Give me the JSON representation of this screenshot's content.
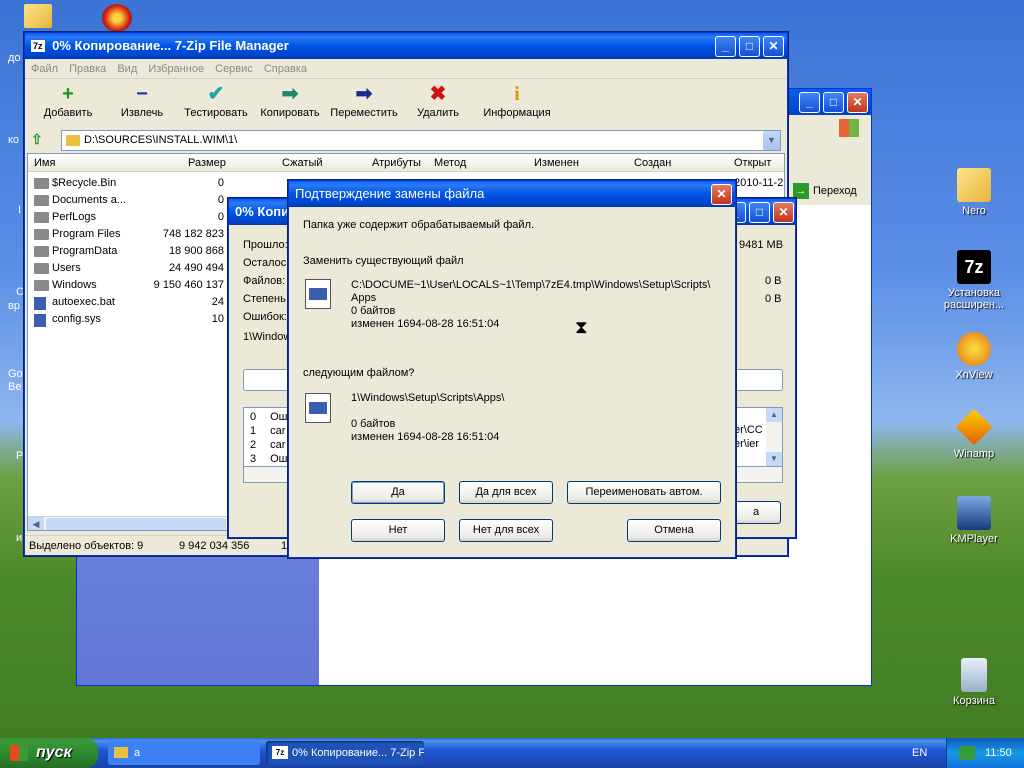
{
  "desktop_icons": [
    {
      "id": "nero",
      "label": "Nero"
    },
    {
      "id": "7zip",
      "label": "Установка расширен..."
    },
    {
      "id": "xnview",
      "label": "XnView"
    },
    {
      "id": "winamp",
      "label": "Winamp"
    },
    {
      "id": "kmplayer",
      "label": "KMPlayer"
    },
    {
      "id": "recycle",
      "label": "Корзина"
    }
  ],
  "left_edge_text": [
    "до",
    "ко",
    "I",
    "С",
    "вр",
    "Go",
    "Be",
    "P",
    "и"
  ],
  "explorer_goto": "Переход",
  "main_window": {
    "title": "0% Копирование... 7-Zip File Manager",
    "title_icon": "7z",
    "menu": [
      "Файл",
      "Правка",
      "Вид",
      "Избранное",
      "Сервис",
      "Справка"
    ],
    "toolbar": [
      {
        "label": "Добавить",
        "icon": "+",
        "color": "#1a9a1a"
      },
      {
        "label": "Извлечь",
        "icon": "−",
        "color": "#1a3aa8"
      },
      {
        "label": "Тестировать",
        "icon": "✔",
        "color": "#1aa8a8"
      },
      {
        "label": "Копировать",
        "icon": "➡",
        "color": "#1a8a6a"
      },
      {
        "label": "Переместить",
        "icon": "➡",
        "color": "#1a2a8a"
      },
      {
        "label": "Удалить",
        "icon": "✖",
        "color": "#d01010"
      },
      {
        "label": "Информация",
        "icon": "i",
        "color": "#d0a000"
      }
    ],
    "path": "D:\\SOURCES\\INSTALL.WIM\\1\\",
    "columns": [
      "Имя",
      "Размер",
      "Сжатый",
      "Атрибуты",
      "Метод",
      "Изменен",
      "Создан",
      "Открыт"
    ],
    "rows": [
      {
        "name": "$Recycle.Bin",
        "size": "0",
        "type": "folder",
        "opened": "2010-11-2"
      },
      {
        "name": "Documents a...",
        "size": "0",
        "type": "folder",
        "opened": ""
      },
      {
        "name": "PerfLogs",
        "size": "0",
        "type": "folder",
        "opened": ""
      },
      {
        "name": "Program Files",
        "size": "748 182 823",
        "type": "folder",
        "opened": ""
      },
      {
        "name": "ProgramData",
        "size": "18 900 868",
        "type": "folder",
        "opened": ""
      },
      {
        "name": "Users",
        "size": "24 490 494",
        "type": "folder",
        "opened": ""
      },
      {
        "name": "Windows",
        "size": "9 150 460 137",
        "type": "folder",
        "opened": ""
      },
      {
        "name": "autoexec.bat",
        "size": "24",
        "type": "file",
        "opened": ""
      },
      {
        "name": "config.sys",
        "size": "10",
        "type": "file",
        "opened": ""
      }
    ],
    "status_selected": "Выделено объектов: 9",
    "status_size": "9 942 034 356",
    "status_extra": "1"
  },
  "progress_window": {
    "title": "0% Копи",
    "labels": [
      "Прошло:",
      "Осталось",
      "Файлов:",
      "Степень",
      "Ошибок:"
    ],
    "path_frag": "1\\Window",
    "right_values": [
      "9481 MB",
      "0 B",
      "0 B"
    ],
    "log_nums": [
      "0",
      "1",
      "2",
      "3"
    ],
    "log_texts": [
      "Ош",
      "car",
      "car",
      "Ош"
    ],
    "log_right": [
      "er\\CC",
      "er\\ier"
    ],
    "btn_frag": "а"
  },
  "dialog": {
    "title": "Подтверждение замены файла",
    "line1": "Папка уже содержит обрабатываемый файл.",
    "replace_label": "Заменить существующий файл",
    "existing": {
      "path": "C:\\DOCUME~1\\User\\LOCALS~1\\Temp\\7zE4.tmp\\Windows\\Setup\\Scripts\\",
      "name": "Apps",
      "size": "0 байтов",
      "modified": "изменен 1694-08-28 16:51:04"
    },
    "with_label": "следующим файлом?",
    "new": {
      "path": "1\\Windows\\Setup\\Scripts\\Apps\\",
      "size": "0 байтов",
      "modified": "изменен 1694-08-28 16:51:04"
    },
    "buttons": {
      "yes": "Да",
      "yes_all": "Да для всех",
      "rename": "Переименовать автом.",
      "no": "Нет",
      "no_all": "Нет для всех",
      "cancel": "Отмена"
    }
  },
  "taskbar": {
    "start": "пуск",
    "tasks": [
      "а",
      "0% Копирование... 7-Zip File Manager"
    ],
    "lang": "EN",
    "clock": "11:50"
  }
}
